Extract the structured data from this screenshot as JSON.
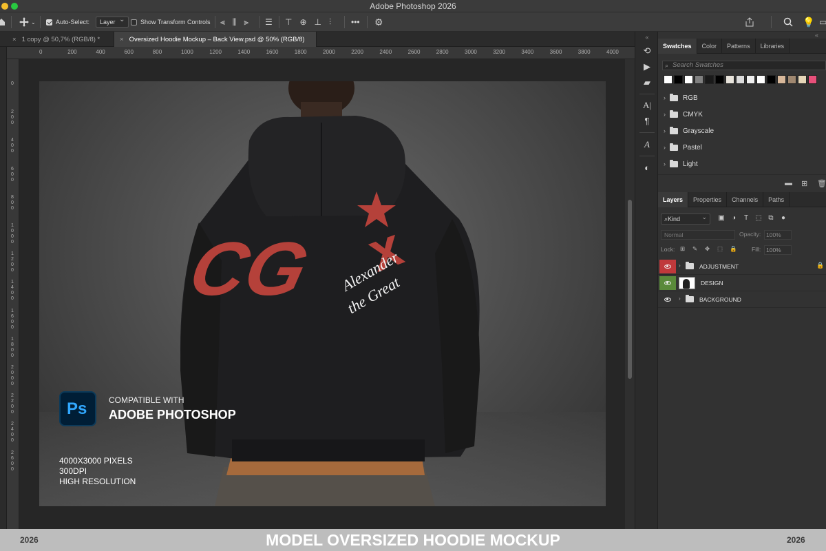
{
  "app": {
    "title": "Adobe Photoshop 2026"
  },
  "options_bar": {
    "auto_select_label": "Auto-Select:",
    "auto_select_value": "Layer",
    "transform_label": "Show Transform Controls",
    "more_label": "•••"
  },
  "tabs": [
    {
      "label": "1 copy @ 50,7% (RGB/8) *"
    },
    {
      "label": "Oversized Hoodie Mockup – Back View.psd @ 50% (RGB/8)"
    }
  ],
  "ruler": {
    "h_ticks": [
      "0",
      "200",
      "400",
      "600",
      "800",
      "1000",
      "1200",
      "1400",
      "1600",
      "1800",
      "2000",
      "2200",
      "2400",
      "2600",
      "2800",
      "3000",
      "3200",
      "3400",
      "3600",
      "3800",
      "4000"
    ],
    "v_ticks": [
      "0",
      "200",
      "400",
      "600",
      "800",
      "1000",
      "1200",
      "1400",
      "1600",
      "1800",
      "2000",
      "2200",
      "2400",
      "2600"
    ]
  },
  "artwork": {
    "compat_line1": "COMPATIBLE WITH",
    "compat_line2": "ADOBE PHOTOSHOP",
    "ps_logo": "Ps",
    "spec1": "4000X3000 PIXELS",
    "spec2": "300DPI",
    "spec3": "HIGH RESOLUTION",
    "logo_main": "CG",
    "logo_x": "x",
    "script_line1": "Alexander",
    "script_line2": "the Great"
  },
  "swatches_panel": {
    "tabs": [
      "Swatches",
      "Color",
      "Patterns",
      "Libraries"
    ],
    "search_placeholder": "Search Swatches",
    "colors": [
      "#ffffff",
      "#000000",
      "#ffffff",
      "#808080",
      "#1a1a1a",
      "#000000",
      "#e8e4dc",
      "#dcdcdc",
      "#f0f0f0",
      "#ffffff",
      "#000000",
      "#d8b89a",
      "#a08870",
      "#e6d6b8",
      "#e8507a"
    ],
    "groups": [
      "RGB",
      "CMYK",
      "Grayscale",
      "Pastel",
      "Light"
    ]
  },
  "layers_panel": {
    "tabs": [
      "Layers",
      "Properties",
      "Channels",
      "Paths"
    ],
    "kind_label": "Kind",
    "blend_mode": "Normal",
    "opacity_label": "Opacity:",
    "opacity_value": "100%",
    "lock_label": "Lock:",
    "fill_label": "Fill:",
    "fill_value": "100%",
    "layers": [
      {
        "name": "ADJUSTMENT",
        "eye_color": "#c0393b",
        "type": "group",
        "locked": true
      },
      {
        "name": "DESIGN",
        "eye_color": "#5a8a3a",
        "type": "image"
      },
      {
        "name": "BACKGROUND",
        "eye_color": "none",
        "type": "group"
      }
    ]
  },
  "footer": {
    "title": "MODEL OVERSIZED HOODIE MOCKUP",
    "year_left": "2026",
    "year_right": "2026"
  },
  "colors": {
    "logo_red": "#b5413a",
    "ps_blue": "#31a8ff",
    "ps_bg": "#001e36"
  }
}
